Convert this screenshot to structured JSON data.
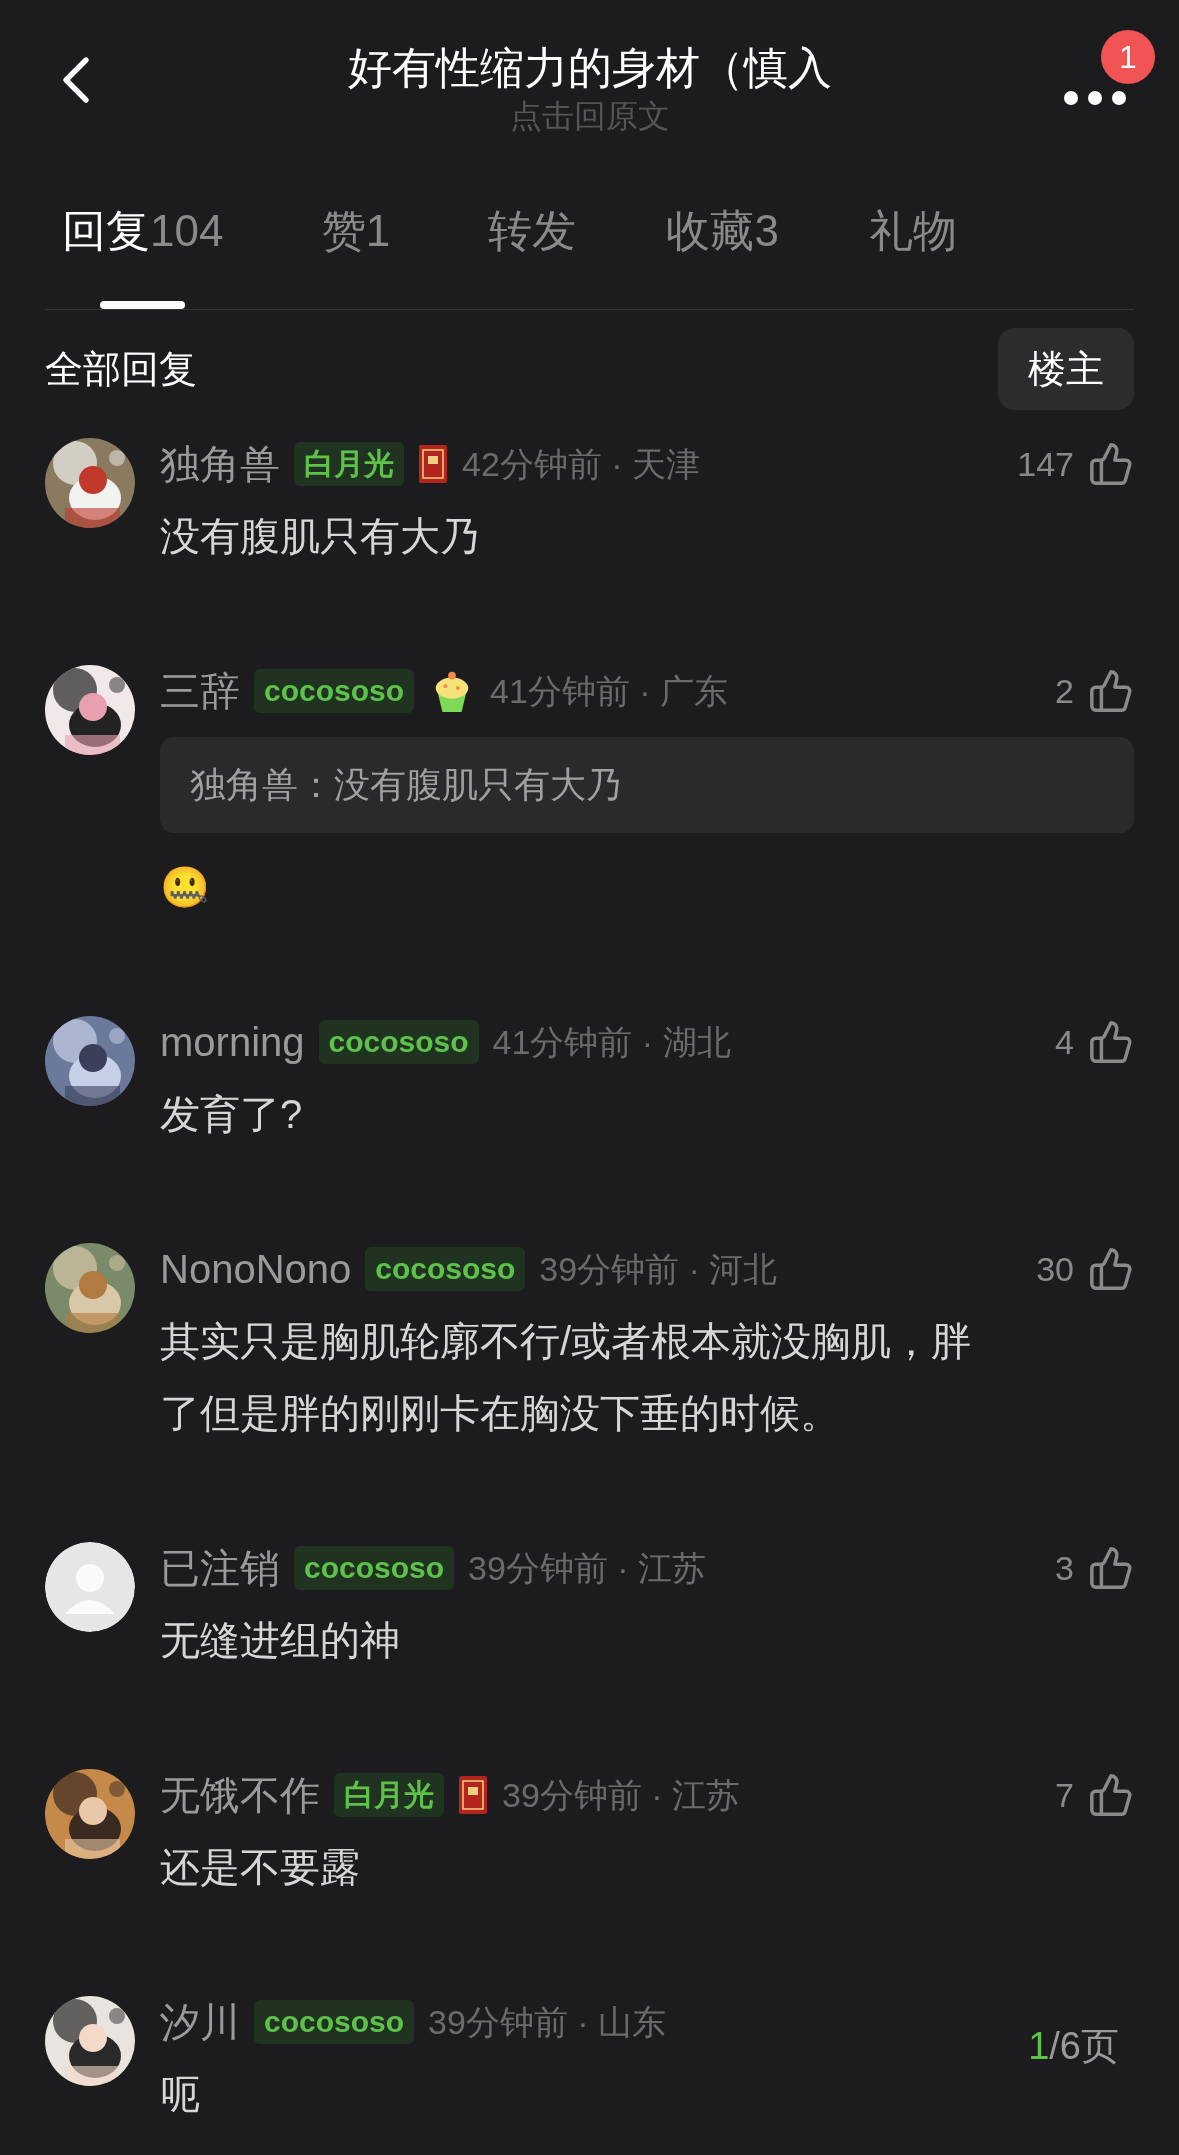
{
  "header": {
    "title": "好有性缩力的身材（慎入",
    "subtitle": "点击回原文",
    "notification_count": "1"
  },
  "tabs": [
    {
      "label": "回复",
      "count": "104",
      "selected": true
    },
    {
      "label": "赞",
      "count": "1",
      "selected": false
    },
    {
      "label": "转发",
      "selected": false
    },
    {
      "label": "收藏",
      "count": "3",
      "selected": false
    },
    {
      "label": "礼物",
      "selected": false
    }
  ],
  "filter": {
    "label": "全部回复",
    "button": "楼主"
  },
  "comments": [
    {
      "name": "独角兽",
      "badge": "白月光",
      "badge_icon": {
        "kind": "book"
      },
      "meta": "42分钟前 · 天津",
      "likes": "147",
      "body": "没有腹肌只有大乃"
    },
    {
      "name": "三辞",
      "badge": "cocososo",
      "badge_icon": {
        "kind": "cupcake"
      },
      "meta": "41分钟前 · 广东",
      "likes": "2",
      "quote": "独角兽：没有腹肌只有大乃",
      "body": "🤐"
    },
    {
      "name": "morning",
      "badge": "cocososo",
      "meta": "41分钟前 · 湖北",
      "likes": "4",
      "body": "发育了?"
    },
    {
      "name": "NonoNono",
      "badge": "cocososo",
      "meta": "39分钟前 · 河北",
      "likes": "30",
      "body": "其实只是胸肌轮廓不行/或者根本就没胸肌，胖了但是胖的刚刚卡在胸没下垂的时候。"
    },
    {
      "avatar": {
        "kind": "default"
      },
      "name": "已注销",
      "badge": "cocososo",
      "meta": "39分钟前 · 江苏",
      "likes": "3",
      "body": "无缝进组的神"
    },
    {
      "name": "无饿不作",
      "badge": "白月光",
      "badge_icon": {
        "kind": "book"
      },
      "meta": "39分钟前 · 江苏",
      "likes": "7",
      "body": "还是不要露"
    },
    {
      "name": "汐川",
      "badge": "cocososo",
      "meta": "39分钟前 · 山东",
      "body": "呃"
    }
  ],
  "pager": {
    "current": "1",
    "total": "/6页"
  }
}
